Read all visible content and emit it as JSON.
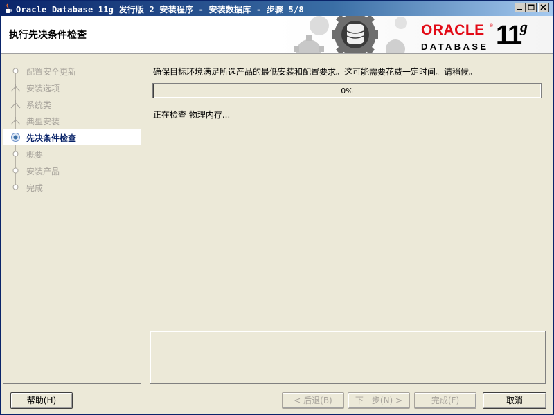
{
  "window": {
    "title": "Oracle Database 11g 发行版 2 安装程序 - 安装数据库 - 步骤 5/8"
  },
  "banner": {
    "step_title": "执行先决条件检查",
    "logo_oracle": "ORACLE",
    "logo_database": "DATABASE",
    "logo_version": "11",
    "logo_version_suffix": "g"
  },
  "nav": {
    "items": [
      {
        "label": "配置安全更新",
        "state": "done"
      },
      {
        "label": "安装选项",
        "state": "done"
      },
      {
        "label": "系统类",
        "state": "done"
      },
      {
        "label": "典型安装",
        "state": "done"
      },
      {
        "label": "先决条件检查",
        "state": "active"
      },
      {
        "label": "概要",
        "state": "pending"
      },
      {
        "label": "安装产品",
        "state": "pending"
      },
      {
        "label": "完成",
        "state": "pending"
      }
    ]
  },
  "main": {
    "instruction": "确保目标环境满足所选产品的最低安装和配置要求。这可能需要花费一定时间。请稍候。",
    "progress_percent": 0,
    "progress_label": "0%",
    "status": "正在检查 物理内存..."
  },
  "buttons": {
    "help": "帮助(H)",
    "back": "< 后退(B)",
    "next": "下一步(N) >",
    "finish": "完成(F)",
    "cancel": "取消"
  },
  "colors": {
    "title_bar": "#0a246a",
    "oracle_red": "#e20a16",
    "active_step": "#0a246a"
  }
}
